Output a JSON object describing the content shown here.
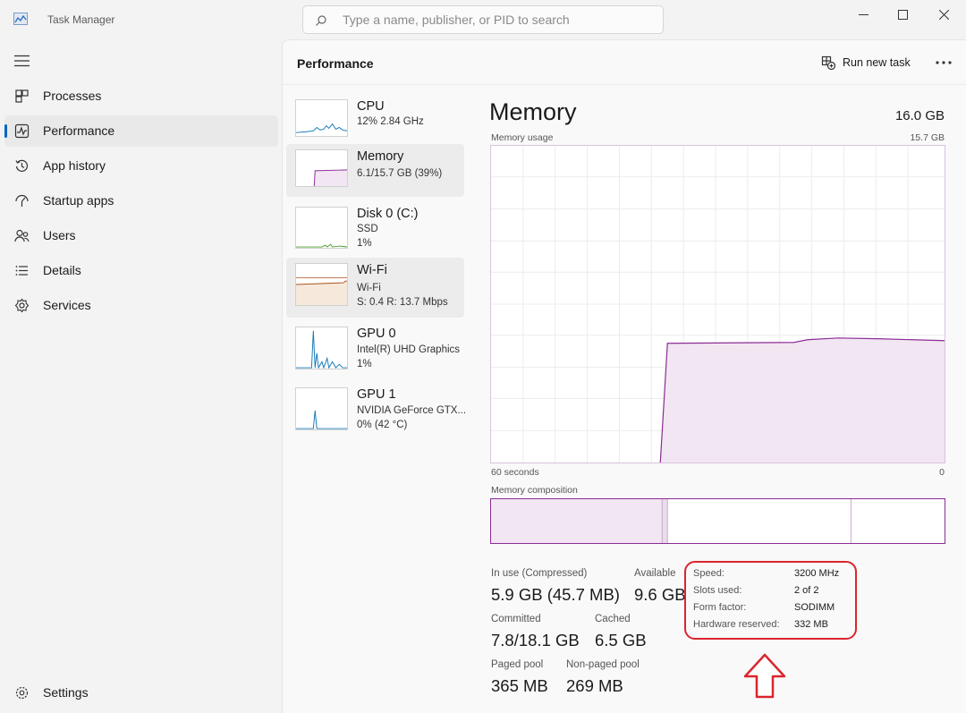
{
  "app": {
    "title": "Task Manager"
  },
  "search": {
    "placeholder": "Type a name, publisher, or PID to search"
  },
  "sidebar": {
    "items": [
      {
        "label": "Processes",
        "icon": "processes-icon"
      },
      {
        "label": "Performance",
        "icon": "performance-icon",
        "active": true
      },
      {
        "label": "App history",
        "icon": "history-icon"
      },
      {
        "label": "Startup apps",
        "icon": "startup-icon"
      },
      {
        "label": "Users",
        "icon": "users-icon"
      },
      {
        "label": "Details",
        "icon": "details-icon"
      },
      {
        "label": "Services",
        "icon": "services-icon"
      }
    ],
    "settings_label": "Settings"
  },
  "header": {
    "title": "Performance",
    "run_task_label": "Run new task"
  },
  "devices": [
    {
      "name": "CPU",
      "line1": "12%  2.84 GHz",
      "line2": ""
    },
    {
      "name": "Memory",
      "line1": "6.1/15.7 GB (39%)",
      "line2": ""
    },
    {
      "name": "Disk 0 (C:)",
      "line1": "SSD",
      "line2": "1%"
    },
    {
      "name": "Wi-Fi",
      "line1": "Wi-Fi",
      "line2": "S: 0.4  R: 13.7 Mbps"
    },
    {
      "name": "GPU 0",
      "line1": "Intel(R) UHD Graphics",
      "line2": "1%"
    },
    {
      "name": "GPU 1",
      "line1": "NVIDIA GeForce GTX...",
      "line2": "0%  (42 °C)"
    }
  ],
  "memory": {
    "title": "Memory",
    "total": "16.0 GB",
    "usage_label": "Memory usage",
    "usage_max": "15.7 GB",
    "time_left": "60 seconds",
    "time_right": "0",
    "composition_label": "Memory composition",
    "in_use_label": "In use (Compressed)",
    "in_use_value": "5.9 GB (45.7 MB)",
    "available_label": "Available",
    "available_value": "9.6 GB",
    "committed_label": "Committed",
    "committed_value": "7.8/18.1 GB",
    "cached_label": "Cached",
    "cached_value": "6.5 GB",
    "paged_label": "Paged pool",
    "paged_value": "365 MB",
    "nonpaged_label": "Non-paged pool",
    "nonpaged_value": "269 MB",
    "speed_label": "Speed:",
    "speed_value": "3200 MHz",
    "slots_label": "Slots used:",
    "slots_value": "2 of 2",
    "form_label": "Form factor:",
    "form_value": "SODIMM",
    "reserved_label": "Hardware reserved:",
    "reserved_value": "332 MB"
  },
  "colors": {
    "accent": "#0067c0",
    "memory": "#8b2c95",
    "highlight": "#d9262e"
  }
}
